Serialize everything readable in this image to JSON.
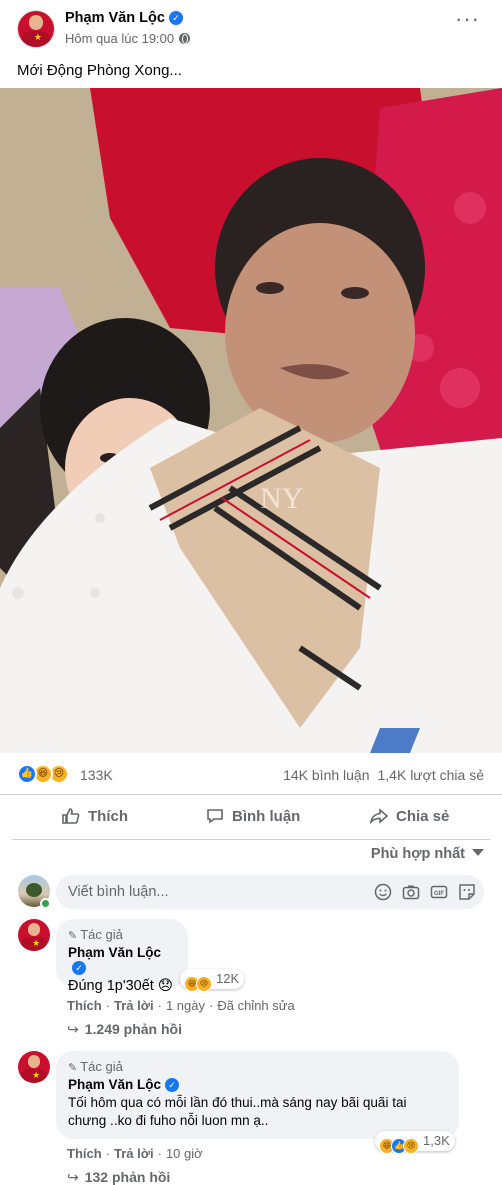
{
  "post": {
    "author": "Phạm Văn Lộc",
    "time": "Hôm qua lúc 19:00",
    "caption": "Mới Động Phòng Xong..."
  },
  "stats": {
    "reaction_count": "133K",
    "comments": "14K bình luận",
    "shares": "1,4K lượt chia sẻ",
    "reaction_icons": [
      "like-icon",
      "haha-icon",
      "sad-icon"
    ]
  },
  "actions": {
    "like": "Thích",
    "comment": "Bình luận",
    "share": "Chia sẻ"
  },
  "sort": {
    "label": "Phù hợp nhất"
  },
  "composer": {
    "placeholder": "Viết bình luận..."
  },
  "comments": [
    {
      "badge": "Tác giả",
      "author": "Phạm Văn Lộc",
      "text": "Đúng 1p'30ết 😞",
      "reaction_count": "12K",
      "like": "Thích",
      "reply": "Trả lời",
      "time": "1 ngày",
      "edited": "Đã chỉnh sửa",
      "replies": "1.249 phản hồi"
    },
    {
      "badge": "Tác giả",
      "author": "Phạm Văn Lộc",
      "text_line1": "Tối hôm qua có mỗi lần đó thui..mà sáng nay bãi quãi tai",
      "text_line2": "chưng ..ko đi fuho nỗi luon mn ạ..",
      "reaction_count": "1,3K",
      "like": "Thích",
      "reply": "Trả lời",
      "time": "10 giờ",
      "replies": "132 phản hồi"
    }
  ],
  "colors": {
    "accent": "#1877f2",
    "secondary_text": "#65676b",
    "bubble": "#f0f2f5"
  }
}
